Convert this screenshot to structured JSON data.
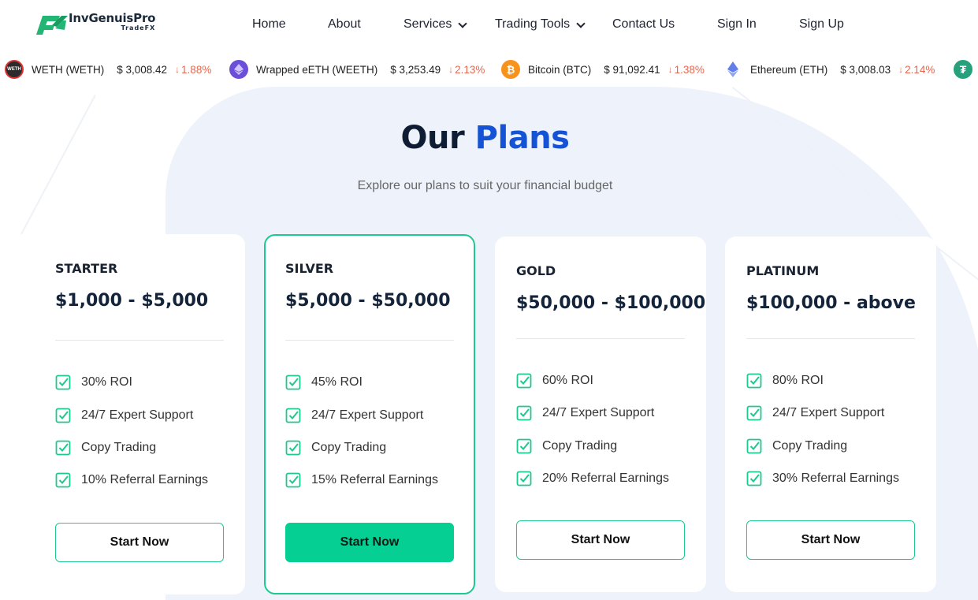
{
  "brand": {
    "name": "InvGenuisPro",
    "sub": "TradeFX",
    "logo_icon": "logo-mark-icon",
    "accent": "#1cc98f"
  },
  "nav": {
    "home": "Home",
    "about": "About",
    "services": "Services",
    "trading_tools": "Trading Tools",
    "contact": "Contact Us",
    "sign_in": "Sign In",
    "sign_up": "Sign Up"
  },
  "ticker": [
    {
      "name": "WETH (WETH)",
      "price": "$ 3,008.42",
      "change": "1.88%",
      "icon_text": "WETH",
      "icon_color": "#2b2b2b"
    },
    {
      "name": "Wrapped eETH (WEETH)",
      "price": "$ 3,253.49",
      "change": "2.13%",
      "icon_text": "",
      "icon_color": "#6b4fd8"
    },
    {
      "name": "Bitcoin (BTC)",
      "price": "$ 91,092.41",
      "change": "1.38%",
      "icon_text": "₿",
      "icon_color": "#f7931a"
    },
    {
      "name": "Ethereum (ETH)",
      "price": "$ 3,008.03",
      "change": "2.14%",
      "icon_text": "",
      "icon_color": "#627eea"
    },
    {
      "name": "",
      "price": "",
      "change": "",
      "icon_text": "₮",
      "icon_color": "#26a17b"
    }
  ],
  "section": {
    "title_main": "Our",
    "title_accent": "Plans",
    "subtitle": "Explore our plans to suit your financial budget"
  },
  "plans": [
    {
      "name": "STARTER",
      "range": "$1,000 - $5,000",
      "features": [
        "30% ROI",
        "24/7 Expert Support",
        "Copy Trading",
        "10% Referral Earnings"
      ],
      "button": "Start Now"
    },
    {
      "name": "SILVER",
      "range": "$5,000 - $50,000",
      "features": [
        "45% ROI",
        "24/7 Expert Support",
        "Copy Trading",
        "15% Referral Earnings"
      ],
      "button": "Start Now"
    },
    {
      "name": "GOLD",
      "range": "$50,000 - $100,000",
      "features": [
        "60% ROI",
        "24/7 Expert Support",
        "Copy Trading",
        "20% Referral Earnings"
      ],
      "button": "Start Now"
    },
    {
      "name": "PLATINUM",
      "range": "$100,000 - above",
      "features": [
        "80% ROI",
        "24/7 Expert Support",
        "Copy Trading",
        "30% Referral Earnings"
      ],
      "button": "Start Now"
    }
  ]
}
